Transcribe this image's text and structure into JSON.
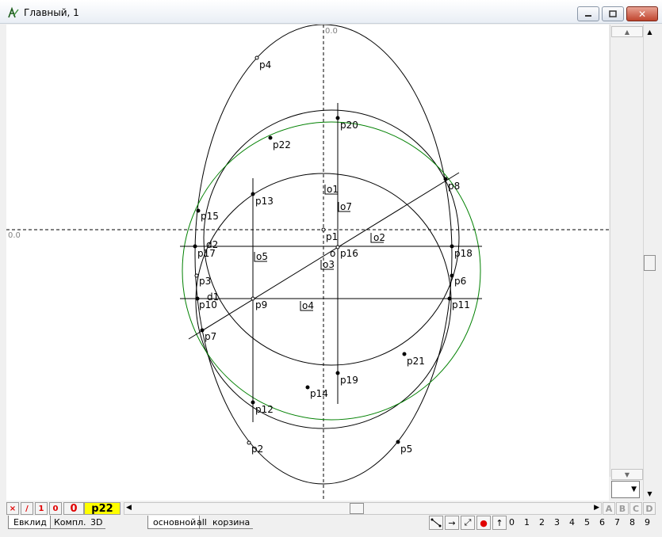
{
  "window": {
    "title": "Главный, 1",
    "icon": "geometry-app-icon",
    "controls": {
      "minimize": "minimize-icon",
      "maximize": "maximize-icon",
      "close": "close-icon"
    }
  },
  "axes": {
    "origin_x_label": "0.0",
    "origin_y_label": "0.0"
  },
  "points": [
    {
      "label": "p1"
    },
    {
      "label": "p2"
    },
    {
      "label": "p3"
    },
    {
      "label": "p4"
    },
    {
      "label": "p5"
    },
    {
      "label": "p6"
    },
    {
      "label": "p7"
    },
    {
      "label": "p8"
    },
    {
      "label": "p9"
    },
    {
      "label": "p10"
    },
    {
      "label": "p11"
    },
    {
      "label": "p12"
    },
    {
      "label": "p13"
    },
    {
      "label": "p14"
    },
    {
      "label": "p15"
    },
    {
      "label": "p16"
    },
    {
      "label": "p17"
    },
    {
      "label": "p18"
    },
    {
      "label": "p19"
    },
    {
      "label": "p20"
    },
    {
      "label": "p21"
    },
    {
      "label": "p22"
    }
  ],
  "objects": [
    {
      "label": "o1"
    },
    {
      "label": "o2"
    },
    {
      "label": "o3"
    },
    {
      "label": "o4"
    },
    {
      "label": "o5"
    },
    {
      "label": "o7"
    },
    {
      "label": "d1"
    },
    {
      "label": "d2"
    },
    {
      "label": "o"
    }
  ],
  "toolbar": {
    "x_btn": "×",
    "slash_btn": "/",
    "one_btn": "1",
    "zero_btn": "0",
    "counter": "0",
    "current_point": "p22",
    "letters": [
      "A",
      "B",
      "C",
      "D"
    ]
  },
  "tabs": {
    "left": [
      "Евклид",
      "Компл.",
      "3D"
    ],
    "layers": [
      "основной",
      "all",
      "корзина"
    ],
    "active_layer": "основной"
  },
  "digits": [
    "0",
    "1",
    "2",
    "3",
    "4",
    "5",
    "6",
    "7",
    "8",
    "9"
  ],
  "colors": {
    "accent_circle": "#008000",
    "current_point_bg": "#ffff00",
    "red_text": "#e00000"
  }
}
